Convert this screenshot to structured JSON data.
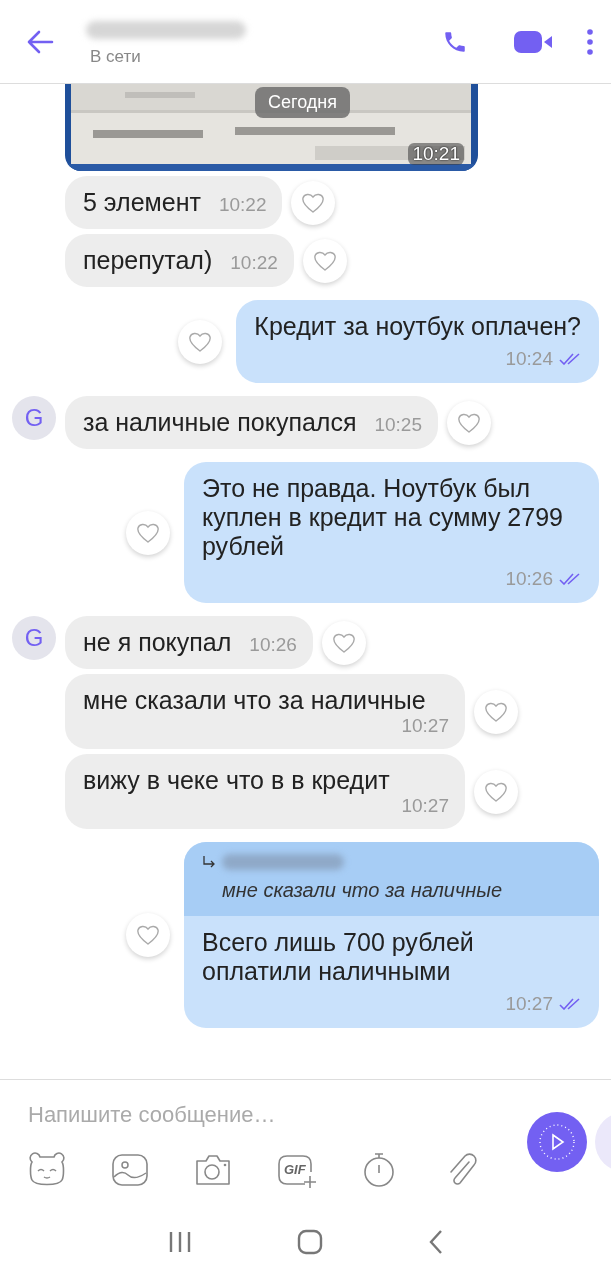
{
  "header": {
    "status": "В сети"
  },
  "photo": {
    "date_chip": "Сегодня",
    "time": "10:21"
  },
  "messages": [
    {
      "kind": "incoming",
      "text": "5 элемент",
      "time": "10:22"
    },
    {
      "kind": "incoming",
      "text": "перепутал)",
      "time": "10:22"
    },
    {
      "kind": "outgoing",
      "text": "Кредит за ноутбук оплачен?",
      "time": "10:24",
      "read": true
    },
    {
      "kind": "incoming",
      "avatar": "G",
      "text": "за наличные покупался",
      "time": "10:25"
    },
    {
      "kind": "outgoing",
      "text": "Это не правда. Ноутбук был куплен в кредит на сумму 2799 рублей",
      "time": "10:26",
      "read": true
    },
    {
      "kind": "incoming",
      "avatar": "G",
      "text": "не я покупал",
      "time": "10:26"
    },
    {
      "kind": "incoming",
      "text": "мне сказали что за наличные",
      "time": "10:27"
    },
    {
      "kind": "incoming",
      "text": "вижу в чеке что в в кредит",
      "time": "10:27"
    },
    {
      "kind": "outgoing",
      "quote": "мне сказали что за наличные",
      "text": "Всего лишь 700 рублей оплатили наличными",
      "time": "10:27",
      "read": true
    }
  ],
  "composer": {
    "placeholder": "Напишите сообщение…",
    "gif_label": "GIF"
  }
}
